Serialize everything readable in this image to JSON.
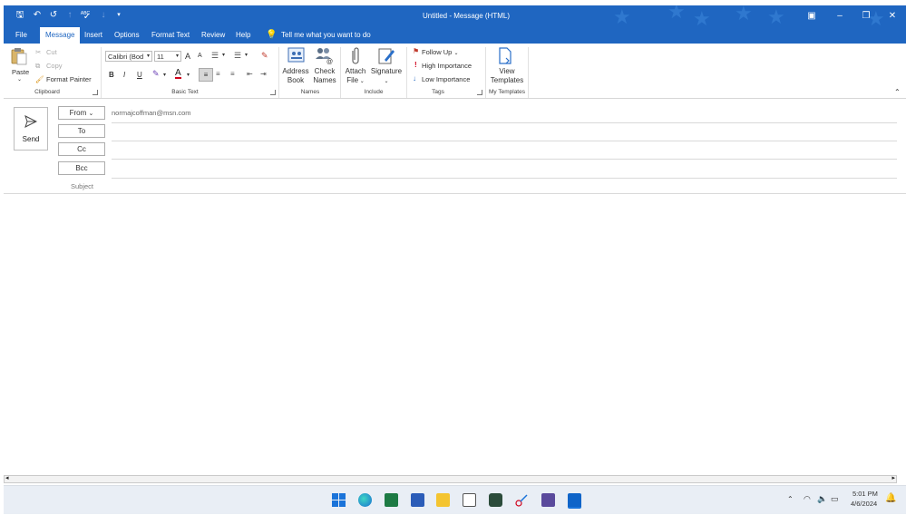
{
  "window": {
    "title": "Untitled  -  Message (HTML)",
    "minimize": "–",
    "restore": "❐",
    "close": "✕"
  },
  "quick_access": {
    "save": "🖫",
    "undo": "↶",
    "redo": "↺",
    "up": "↑",
    "spelling": "ABC",
    "down": "↓",
    "customize": "▾"
  },
  "tabs": [
    "File",
    "Message",
    "Insert",
    "Options",
    "Format Text",
    "Review",
    "Help"
  ],
  "tell_me": "Tell me what you want to do",
  "ribbon": {
    "clipboard": {
      "paste": "Paste",
      "cut": "Cut",
      "copy": "Copy",
      "format_painter": "Format Painter",
      "label": "Clipboard"
    },
    "basic_text": {
      "font": "Calibri (Bod",
      "size": "11",
      "bold": "B",
      "italic": "I",
      "underline": "U",
      "grow": "A",
      "shrink": "A",
      "label": "Basic Text"
    },
    "names": {
      "address_book_1": "Address",
      "address_book_2": "Book",
      "check_names_1": "Check",
      "check_names_2": "Names",
      "label": "Names"
    },
    "include": {
      "attach_1": "Attach",
      "attach_2": "File",
      "signature": "Signature",
      "label": "Include"
    },
    "tags": {
      "follow_up": "Follow Up",
      "high": "High Importance",
      "low": "Low Importance",
      "label": "Tags"
    },
    "templates": {
      "view_1": "View",
      "view_2": "Templates",
      "label": "My Templates"
    }
  },
  "compose": {
    "send": "Send",
    "from_label": "From",
    "from_value": "normajcoffman@msn.com",
    "to": "To",
    "cc": "Cc",
    "bcc": "Bcc",
    "subject": "Subject"
  },
  "taskbar": {
    "time": "5:01 PM",
    "date": "4/6/2024"
  },
  "colors": {
    "accent": "#1f66c1",
    "ribbon_bg": "#ffffff"
  }
}
